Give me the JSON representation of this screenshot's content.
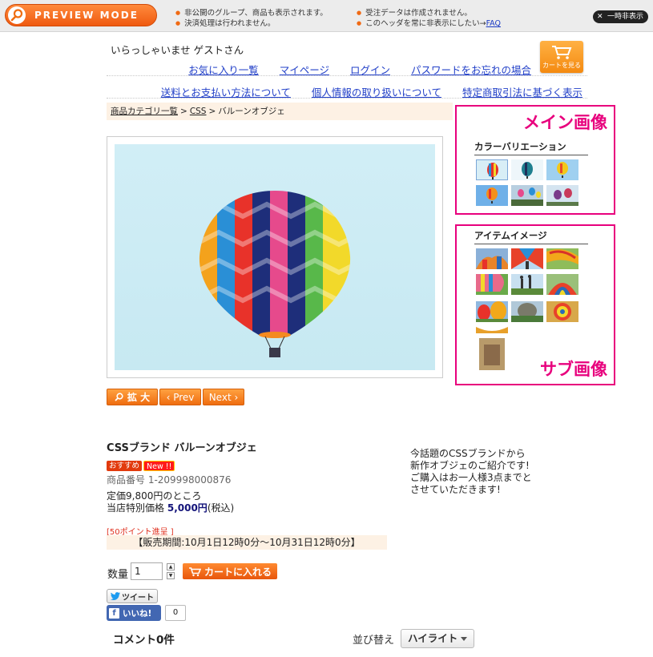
{
  "preview": {
    "mode_label": "PREVIEW MODE",
    "notes_left": [
      "非公開のグループ、商品も表示されます。",
      "決済処理は行われません。"
    ],
    "notes_right": [
      "受注データは作成されません。",
      "このヘッダを常に非表示にしたい→"
    ],
    "faq_link": "FAQ",
    "hide_button": "一時非表示"
  },
  "header": {
    "greeting": "いらっしゃいませ ゲストさん",
    "nav_primary": [
      "お気に入り一覧",
      "マイページ",
      "ログイン",
      "パスワードをお忘れの場合"
    ],
    "nav_secondary": [
      "送料とお支払い方法について",
      "個人情報の取り扱いについて",
      "特定商取引法に基づく表示"
    ],
    "cart_button": "カートを見る"
  },
  "breadcrumb": {
    "root": "商品カテゴリ一覧",
    "category": "CSS",
    "current": "バルーンオブジェ",
    "separator": ">"
  },
  "gallery": {
    "zoom_label": "拡 大",
    "prev_label": "‹ Prev",
    "next_label": "Next ›",
    "color_variation_title": "カラーバリエーション",
    "item_image_title": "アイテムイメージ",
    "main_image_annotation": "メイン画像",
    "sub_image_annotation": "サブ画像"
  },
  "product": {
    "name": "CSSブランド バルーンオブジェ",
    "badge_recommend": "おすすめ",
    "badge_new": "New !!",
    "number": "商品番号 1-209998000876",
    "regular_price": "定価9,800円のところ",
    "special_label": "当店特別価格",
    "special_price": "5,000円",
    "tax_note": "(税込)",
    "points": "[50ポイント進呈 ]",
    "sale_period": "【販売期間:10月1日12時0分〜10月31日12時0分】",
    "description": [
      "今話題のCSSブランドから",
      "新作オブジェのご紹介です!",
      "ご購入はお一人様3点までと",
      "させていただきます!"
    ]
  },
  "purchase": {
    "qty_label": "数量",
    "qty_value": "1",
    "add_to_cart": "カートに入れる"
  },
  "social": {
    "tweet": "ツイート",
    "like": "いいね!",
    "like_count": "0"
  },
  "comments": {
    "title": "コメント0件",
    "sort_label": "並び替え",
    "sort_value": "ハイライト"
  },
  "colors": {
    "accent_orange": "#ef6d10",
    "annotation_pink": "#e8007d",
    "link_blue": "#2240c8"
  }
}
